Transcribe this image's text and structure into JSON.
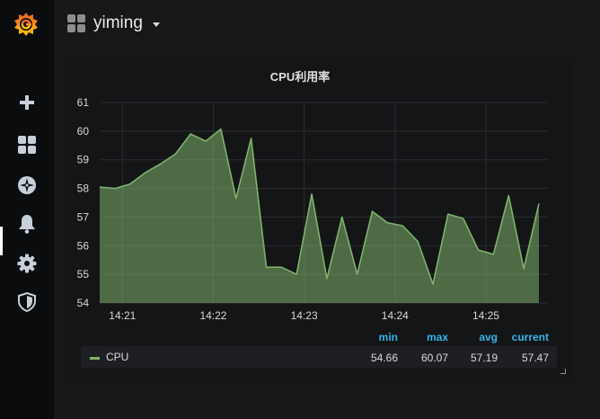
{
  "header": {
    "dashboard_title": "yiming",
    "grid_icon": "grid-icon",
    "caret_icon": "caret-down-icon"
  },
  "sidebar": {
    "logo": "grafana-logo",
    "items": [
      {
        "icon": "plus-icon",
        "label": "create"
      },
      {
        "icon": "dashboards-icon",
        "label": "dashboards"
      },
      {
        "icon": "compass-icon",
        "label": "explore"
      },
      {
        "icon": "bell-icon",
        "label": "alerting"
      },
      {
        "icon": "gear-icon",
        "label": "configuration"
      },
      {
        "icon": "shield-icon",
        "label": "server-admin"
      }
    ]
  },
  "panel": {
    "title": "CPU利用率"
  },
  "legend": {
    "headers": [
      "min",
      "max",
      "avg",
      "current"
    ],
    "series_name": "CPU",
    "values": [
      "54.66",
      "60.07",
      "57.19",
      "57.47"
    ]
  },
  "colors": {
    "series": "#7eb26d",
    "legend_header": "#33b5e5",
    "background": "#161719"
  },
  "chart_data": {
    "type": "area",
    "title": "CPU利用率",
    "xlabel": "",
    "ylabel": "",
    "ylim": [
      54,
      61
    ],
    "yticks": [
      54,
      55,
      56,
      57,
      58,
      59,
      60,
      61
    ],
    "xticks": [
      "14:21",
      "14:22",
      "14:23",
      "14:24",
      "14:25"
    ],
    "grid": true,
    "legend_position": "bottom",
    "series": [
      {
        "name": "CPU",
        "color": "#7eb26d",
        "x": [
          "14:20:45",
          "14:20:55",
          "14:21:05",
          "14:21:15",
          "14:21:25",
          "14:21:35",
          "14:21:45",
          "14:21:55",
          "14:22:05",
          "14:22:15",
          "14:22:25",
          "14:22:35",
          "14:22:45",
          "14:22:55",
          "14:23:05",
          "14:23:15",
          "14:23:25",
          "14:23:35",
          "14:23:45",
          "14:23:55",
          "14:24:05",
          "14:24:15",
          "14:24:25",
          "14:24:35",
          "14:24:45",
          "14:24:55",
          "14:25:05",
          "14:25:15",
          "14:25:25",
          "14:25:35"
        ],
        "values": [
          58.05,
          58.0,
          58.15,
          58.55,
          58.85,
          59.2,
          59.9,
          59.65,
          60.07,
          57.65,
          59.75,
          55.25,
          55.25,
          55.0,
          57.8,
          54.85,
          57.0,
          55.0,
          57.2,
          56.8,
          56.7,
          56.15,
          54.66,
          57.1,
          56.95,
          55.85,
          55.7,
          57.75,
          55.2,
          57.47
        ]
      }
    ]
  }
}
